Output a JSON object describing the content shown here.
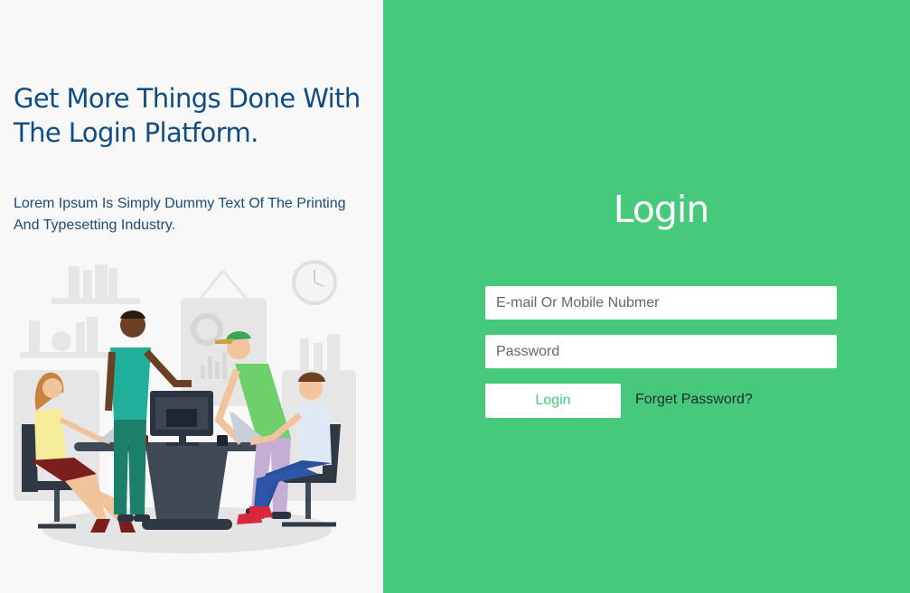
{
  "hero": {
    "headline": "Get More Things Done With The Login Platform.",
    "subtext": "Lorem Ipsum Is Simply Dummy Text Of The Printing And Typesetting Industry."
  },
  "login": {
    "title": "Login",
    "email_placeholder": "E-mail Or Mobile Nubmer",
    "password_placeholder": "Password",
    "submit_label": "Login",
    "forgot_label": "Forget Password?"
  },
  "colors": {
    "accent": "#47c97b",
    "headline": "#0f4c81",
    "left_background": "#f8f8f8"
  }
}
